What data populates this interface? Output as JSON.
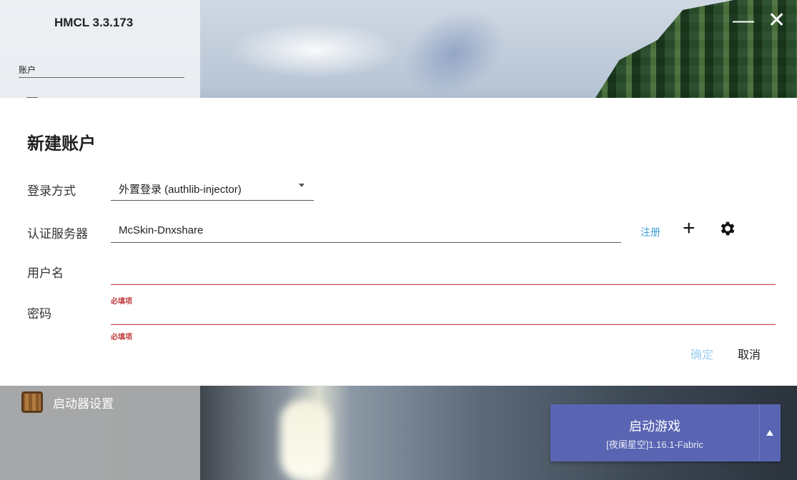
{
  "app": {
    "title": "HMCL 3.3.173"
  },
  "sidebar": {
    "section_label": "账户",
    "items": [
      {
        "label": "启动器设置",
        "icon": "crafting-table-icon"
      }
    ]
  },
  "window_controls": {
    "minimize": "—",
    "close": "✕"
  },
  "dialog": {
    "title": "新建账户",
    "login_method": {
      "label": "登录方式",
      "value": "外置登录 (authlib-injector)"
    },
    "auth_server": {
      "label": "认证服务器",
      "value": "McSkin-Dnxshare",
      "register_link": "注册",
      "add_icon": "plus-icon",
      "settings_icon": "gear-icon"
    },
    "username": {
      "label": "用户名",
      "value": "",
      "error": "必填项"
    },
    "password": {
      "label": "密码",
      "value": "",
      "error": "必填项"
    },
    "confirm_label": "确定",
    "cancel_label": "取消"
  },
  "launch": {
    "title": "启动游戏",
    "subtitle": "[夜阑星空]1.16.1-Fabric"
  },
  "colors": {
    "accent": "#5965b3",
    "error": "#c23a3a",
    "link": "#3aa0d8",
    "confirm_disabled": "#9bd0ee"
  }
}
